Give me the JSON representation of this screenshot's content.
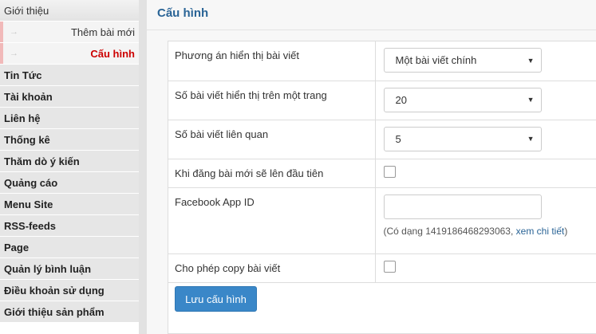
{
  "sidebar": {
    "intro": "Giới thiệu",
    "sub": [
      {
        "arrow": "→",
        "label": "Thêm bài mới"
      },
      {
        "arrow": "→",
        "label": "Cấu hình"
      }
    ],
    "items": [
      "Tin Tức",
      "Tài khoản",
      "Liên hệ",
      "Thống kê",
      "Thăm dò ý kiến",
      "Quảng cáo",
      "Menu Site",
      "RSS-feeds",
      "Page",
      "Quản lý bình luận",
      "Điều khoản sử dụng",
      "Giới thiệu sản phẩm"
    ]
  },
  "main": {
    "title": "Cấu hình",
    "rows": {
      "display_mode": {
        "label": "Phương án hiển thị bài viết",
        "value": "Một bài viết chính"
      },
      "per_page": {
        "label": "Số bài viết hiển thị trên một trang",
        "value": "20"
      },
      "related": {
        "label": "Số bài viết liên quan",
        "value": "5"
      },
      "top_new": {
        "label": "Khi đăng bài mới sẽ lên đầu tiên"
      },
      "facebook": {
        "label": "Facebook App ID",
        "value": "",
        "hint_prefix": "(Có dạng 1419186468293063, ",
        "hint_link": "xem chi tiết",
        "hint_suffix": ")"
      },
      "copy": {
        "label": "Cho phép copy bài viết"
      }
    },
    "save_label": "Lưu cấu hình"
  },
  "icons": {
    "caret": "caret-down-icon",
    "arrow": "arrow-right-icon"
  },
  "colors": {
    "accent": "#3a87c8",
    "title": "#2a6496",
    "active": "#cc0000"
  }
}
